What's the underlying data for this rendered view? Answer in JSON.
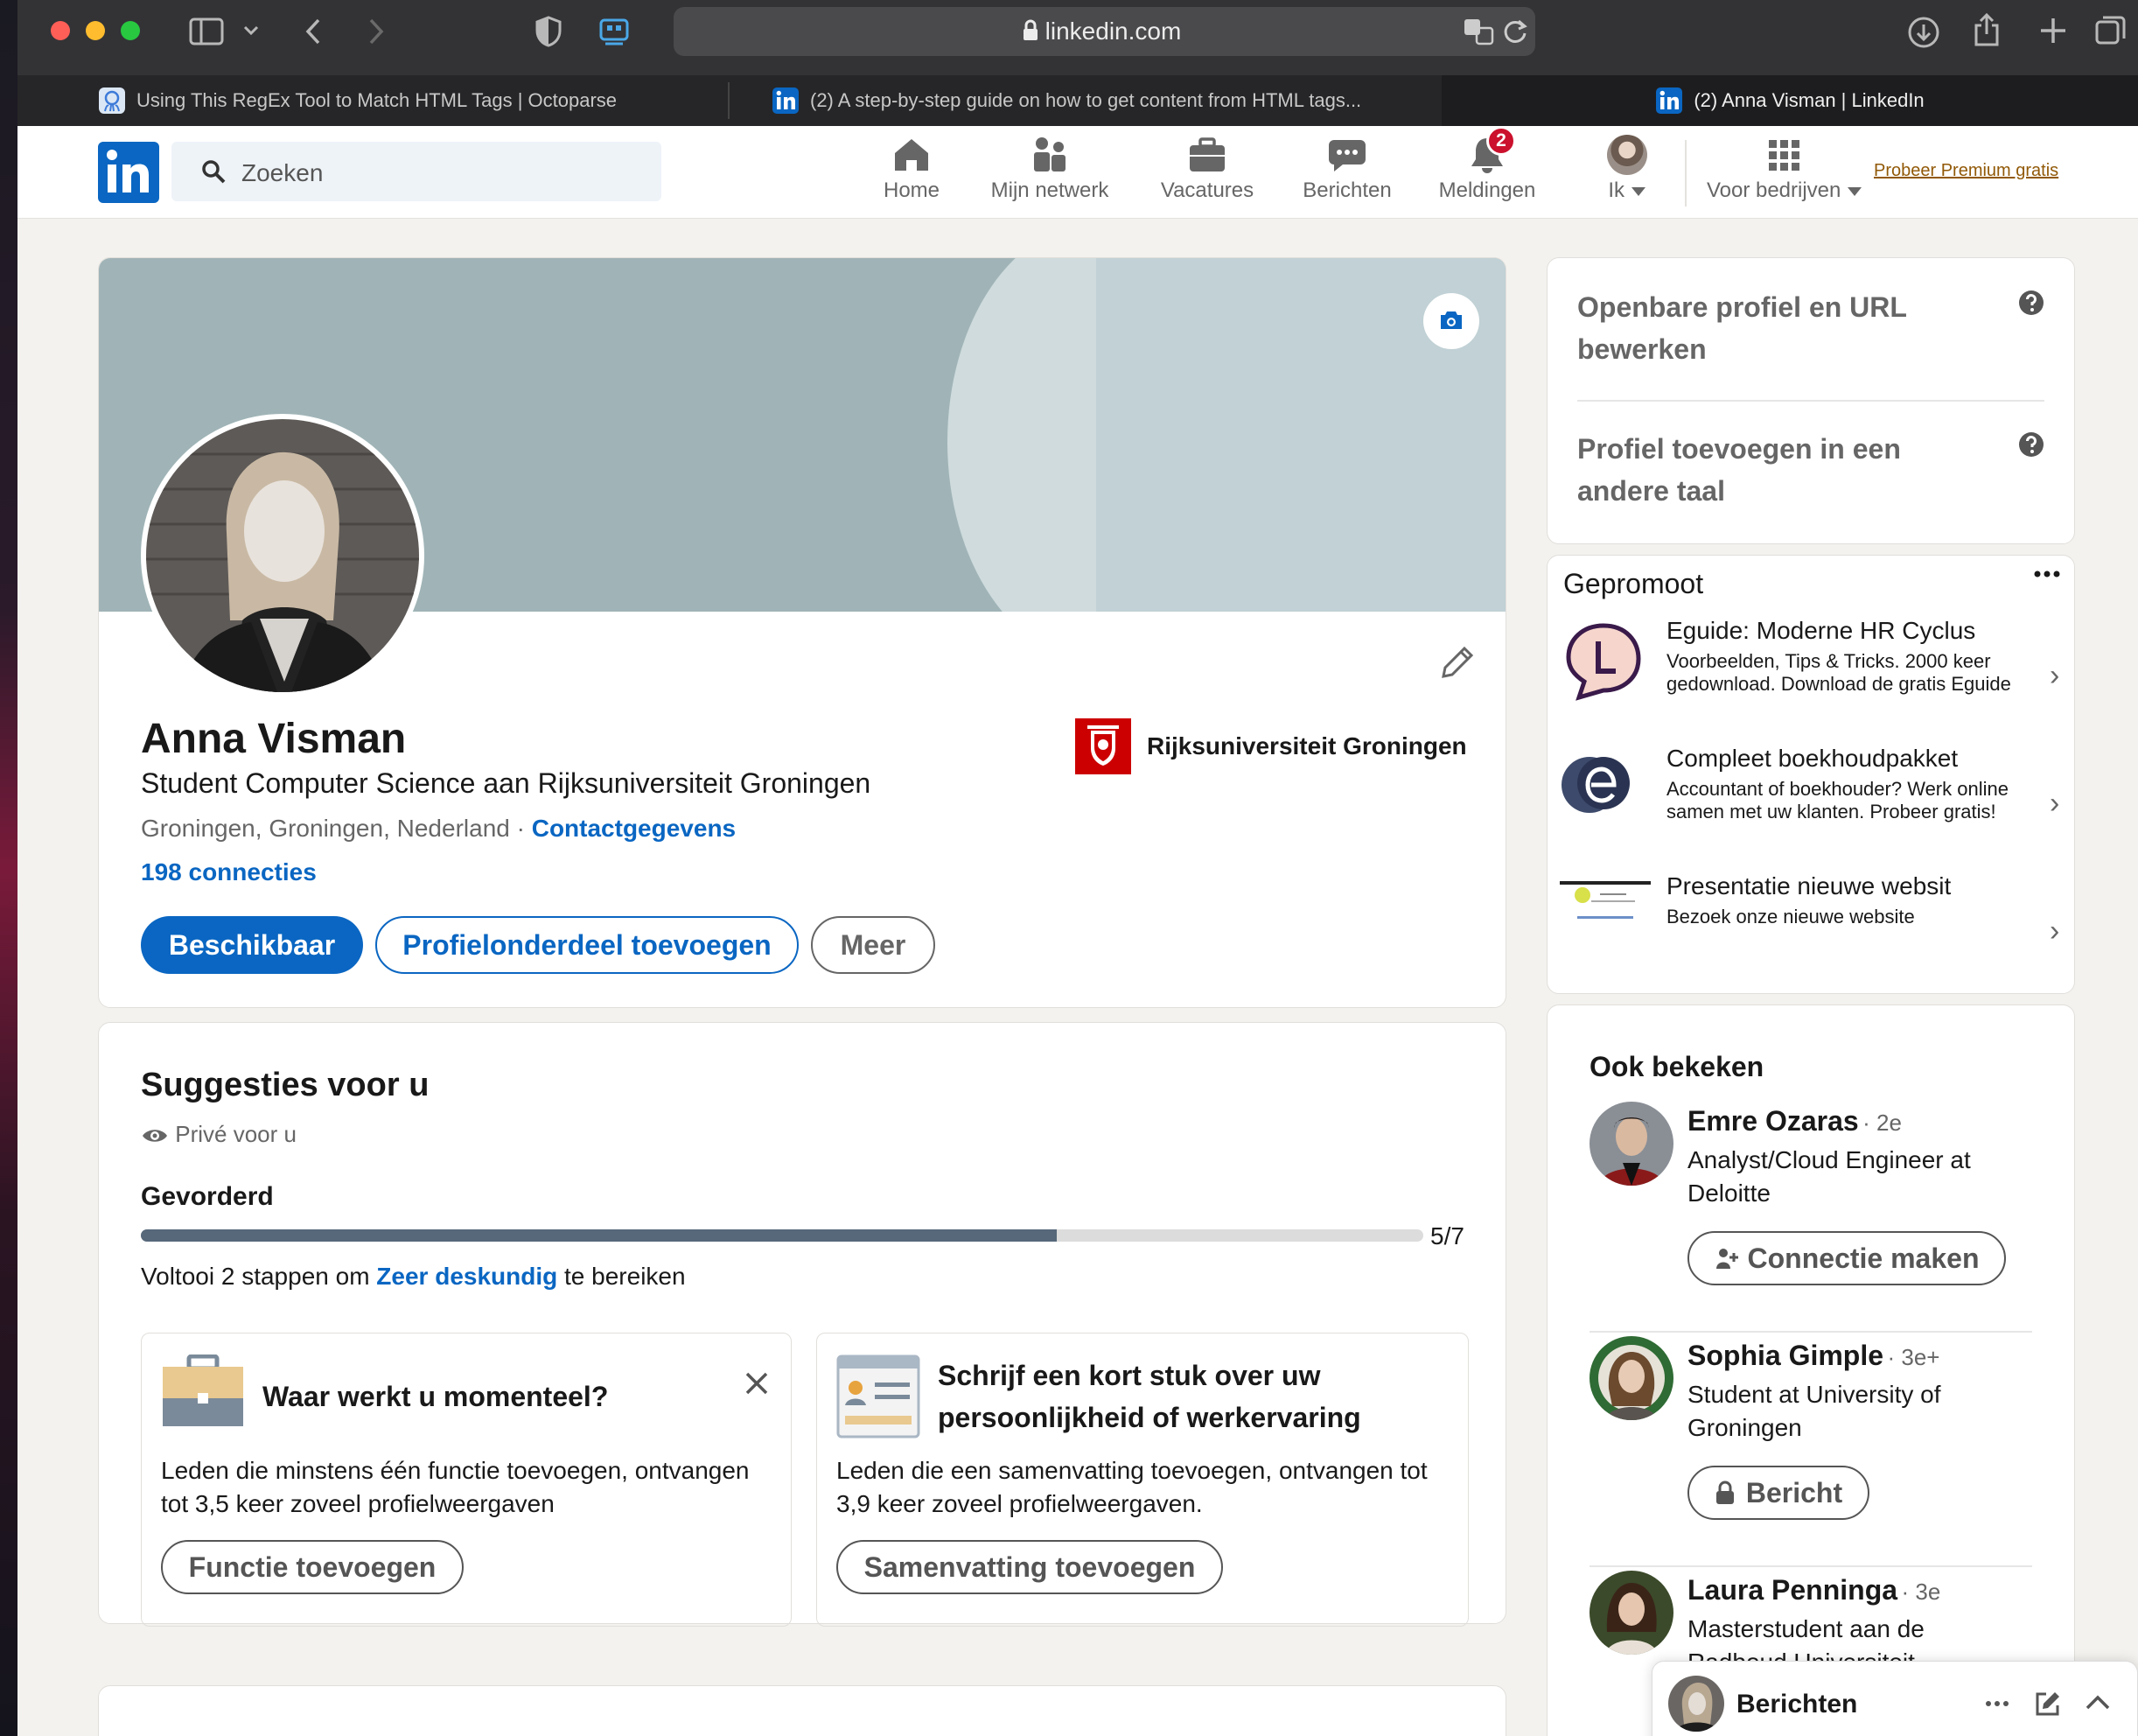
{
  "browser": {
    "url": "linkedin.com",
    "tabs": [
      {
        "title": "Using This RegEx Tool to Match HTML Tags | Octoparse"
      },
      {
        "title": "(2) A step-by-step guide on how to get content from HTML tags..."
      },
      {
        "title": "(2) Anna Visman | LinkedIn"
      }
    ]
  },
  "nav": {
    "search_placeholder": "Zoeken",
    "items": [
      {
        "label": "Home"
      },
      {
        "label": "Mijn netwerk"
      },
      {
        "label": "Vacatures"
      },
      {
        "label": "Berichten"
      },
      {
        "label": "Meldingen"
      },
      {
        "label": "Ik"
      },
      {
        "label": "Voor bedrijven"
      }
    ],
    "notification_count": "2",
    "premium": "Probeer Premium gratis"
  },
  "profile": {
    "name": "Anna Visman",
    "headline": "Student Computer Science aan Rijksuniversiteit Groningen",
    "location": "Groningen, Groningen, Nederland",
    "location_sep": "·",
    "contact_link": "Contactgegevens",
    "connections": "198 connecties",
    "university": "Rijksuniversiteit Groningen",
    "buttons": {
      "available": "Beschikbaar",
      "add_section": "Profielonderdeel toevoegen",
      "more": "Meer"
    }
  },
  "suggestions": {
    "title": "Suggesties voor u",
    "private": "Privé voor u",
    "level": "Gevorderd",
    "progress_label": "5/7",
    "progress_fraction": 0.714,
    "hint_prefix": "Voltooi 2 stappen om",
    "hint_link": "Zeer deskundig",
    "hint_suffix": "te bereiken",
    "cards": [
      {
        "title": "Waar werkt u momenteel?",
        "text": "Leden die minstens één functie toevoegen, ontvangen tot 3,5 keer zoveel profielweergaven",
        "button": "Functie toevoegen"
      },
      {
        "title": "Schrijf een kort stuk over uw persoonlijkheid of werkervaring",
        "text": "Leden die een samenvatting toevoegen, ontvangen tot 3,9 keer zoveel profielweergaven.",
        "button": "Samenvatting toevoegen"
      }
    ]
  },
  "sidebar": {
    "links": [
      {
        "label": "Openbare profiel en URL bewerken"
      },
      {
        "label": "Profiel toevoegen in een andere taal"
      }
    ],
    "promoted": {
      "title": "Gepromoot",
      "ads": [
        {
          "title": "Eguide: Moderne HR Cyclus",
          "text": "Voorbeelden, Tips & Tricks. 2000 keer gedownload. Download de gratis Eguide"
        },
        {
          "title": "Compleet boekhoudpakket",
          "text": "Accountant of boekhouder? Werk online samen met uw klanten. Probeer gratis!"
        },
        {
          "title": "Presentatie nieuwe websit",
          "text": "Bezoek onze nieuwe website"
        }
      ]
    },
    "also_viewed": {
      "title": "Ook bekeken",
      "people": [
        {
          "name": "Emre Ozaras",
          "degree": "· 2e",
          "headline": "Analyst/Cloud Engineer at Deloitte",
          "button": "Connectie maken"
        },
        {
          "name": "Sophia Gimple",
          "degree": "· 3e+",
          "headline": "Student at University of Groningen",
          "button": "Bericht"
        },
        {
          "name": "Laura Penninga",
          "degree": "· 3e",
          "headline": "Masterstudent aan de Radboud Universiteit"
        }
      ]
    }
  },
  "messaging": {
    "label": "Berichten"
  },
  "colors": {
    "accent": "#0a66c2",
    "badge": "#cb112d",
    "page_bg": "#f4f2ee",
    "progress": "#56687a"
  }
}
